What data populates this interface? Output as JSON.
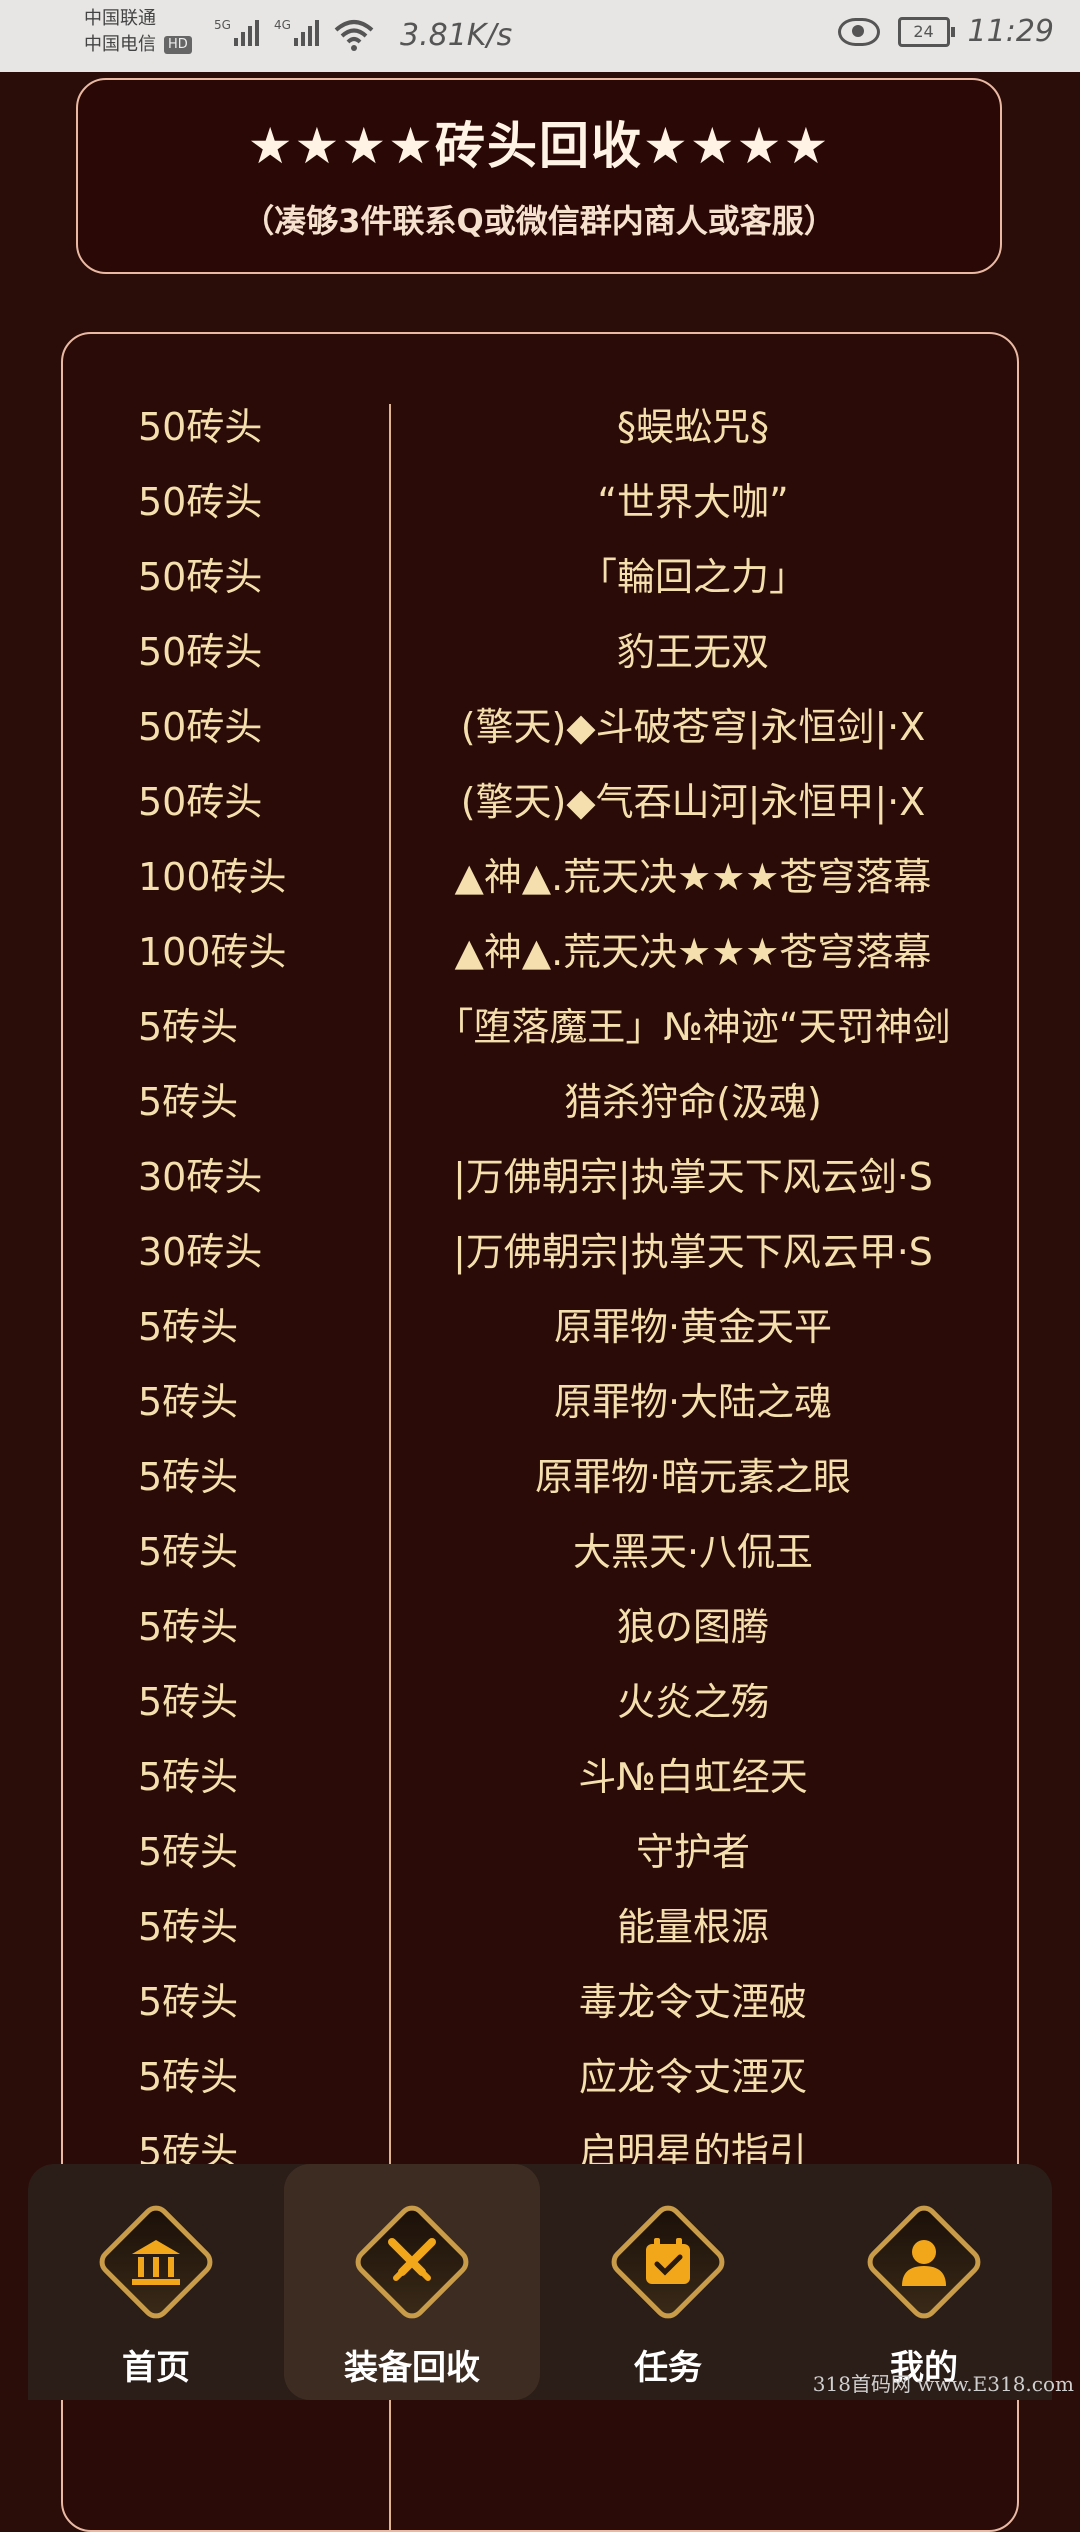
{
  "status_bar": {
    "carrier1": "中国联通",
    "carrier2": "中国电信",
    "hd": "HD",
    "sig1": "5G",
    "sig2": "4G",
    "speed": "3.81K/s",
    "battery": "24",
    "time": "11:29"
  },
  "header": {
    "title": "★★★★砖头回收★★★★",
    "subtitle": "（凑够3件联系Q或微信群内商人或客服）"
  },
  "list": [
    {
      "price": "50砖头",
      "name": "§蜈蚣咒§"
    },
    {
      "price": "50砖头",
      "name": "“世界大咖”"
    },
    {
      "price": "50砖头",
      "name": "「輪回之力」"
    },
    {
      "price": "50砖头",
      "name": "豹王无双"
    },
    {
      "price": "50砖头",
      "name": "(擎天)◆斗破苍穹|永恒剑|·X"
    },
    {
      "price": "50砖头",
      "name": "(擎天)◆气吞山河|永恒甲|·X"
    },
    {
      "price": "100砖头",
      "name": "▲神▲.荒天决★★★苍穹落幕"
    },
    {
      "price": "100砖头",
      "name": "▲神▲.荒天决★★★苍穹落幕"
    },
    {
      "price": "5砖头",
      "name": "「堕落魔王」№神迹“天罚神剑"
    },
    {
      "price": "5砖头",
      "name": "猎杀狩命(汲魂)"
    },
    {
      "price": "30砖头",
      "name": "|万佛朝宗|执掌天下风云剑·S"
    },
    {
      "price": "30砖头",
      "name": "|万佛朝宗|执掌天下风云甲·S"
    },
    {
      "price": "5砖头",
      "name": "原罪物·黄金天平"
    },
    {
      "price": "5砖头",
      "name": "原罪物·大陆之魂"
    },
    {
      "price": "5砖头",
      "name": "原罪物·暗元素之眼"
    },
    {
      "price": "5砖头",
      "name": "大黑天·八侃玉"
    },
    {
      "price": "5砖头",
      "name": "狼の图腾"
    },
    {
      "price": "5砖头",
      "name": "火炎之殇"
    },
    {
      "price": "5砖头",
      "name": "斗№白虹经天"
    },
    {
      "price": "5砖头",
      "name": "守护者"
    },
    {
      "price": "5砖头",
      "name": "能量根源"
    },
    {
      "price": "5砖头",
      "name": "毒龙令丈湮破"
    },
    {
      "price": "5砖头",
      "name": "应龙令丈湮灭"
    },
    {
      "price": "5砖头",
      "name": "启明星的指引"
    }
  ],
  "nav": {
    "home": "首页",
    "recycle": "装备回收",
    "tasks": "任务",
    "me": "我的"
  },
  "watermark": "318首码网 www.E318.com"
}
